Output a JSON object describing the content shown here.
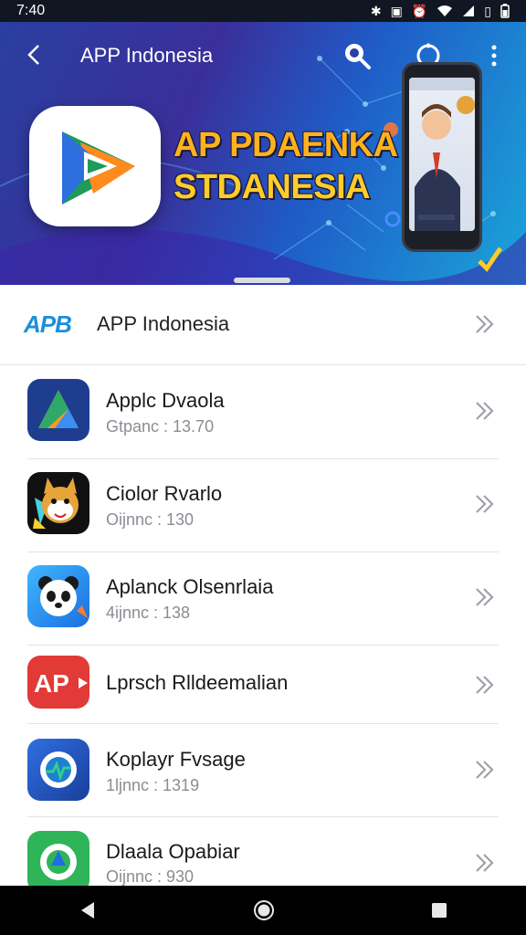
{
  "status_bar": {
    "time": "7:40",
    "icons": [
      "bluetooth-icon",
      "nfc-icon",
      "alarm-icon",
      "wifi-icon",
      "signal-icon",
      "battery-icon"
    ]
  },
  "app_bar": {
    "title": "APP Indonesia",
    "icons": [
      "back-icon",
      "search-icon",
      "circle-icon",
      "more-vert-icon"
    ]
  },
  "banner": {
    "line1": "AP PDAENKA",
    "line2": "STDANESIA"
  },
  "featured": {
    "logo_text": "APB",
    "title": "APP Indonesia"
  },
  "apps": [
    {
      "name": "Applc Dvaola",
      "sub": "Gtpanc : 13.70",
      "icon": "triangle-logo-icon"
    },
    {
      "name": "Ciolor Rvarlo",
      "sub": "Oijnnc : 130",
      "icon": "fox-mascot-icon"
    },
    {
      "name": "Aplanck Olsenrlaia",
      "sub": "4ijnnc : 138",
      "icon": "panda-icon"
    },
    {
      "name": "Lprsch Rlldeemalian",
      "sub": "",
      "icon": "ap-red-logo-icon"
    },
    {
      "name": "Koplayr Fvsage",
      "sub": "1ljnnc : 1319",
      "icon": "circle-chart-icon"
    },
    {
      "name": "Dlaala Opabiar",
      "sub": "Oijnnc : 930",
      "icon": "green-drop-icon"
    }
  ],
  "colors": {
    "accent": "#1c8fd9",
    "banner_text": "#ffb21e",
    "divider": "#e2e4e8"
  }
}
